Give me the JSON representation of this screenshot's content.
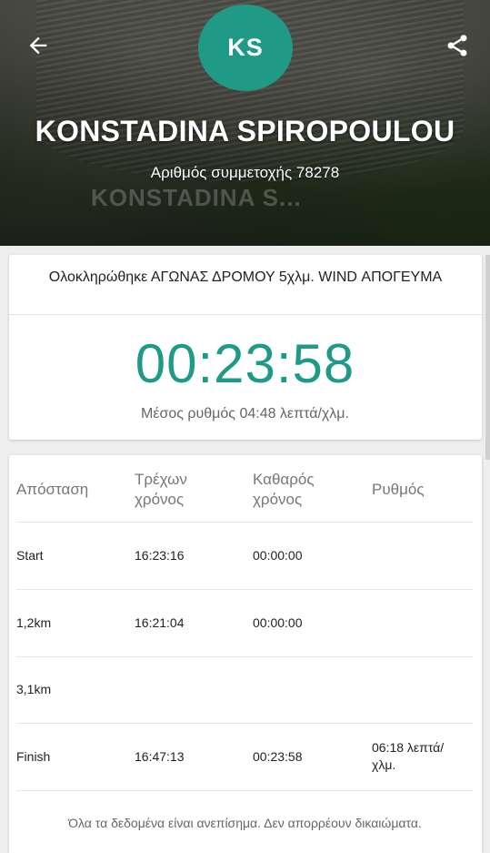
{
  "header": {
    "avatar_initials": "KS",
    "avatar_color": "#1e9a86",
    "athlete_name": "KONSTADINA SPIROPOULOU",
    "bib_text": "Αριθμός συμμετοχής 78278",
    "watermark_text": "KONSTADINA S...",
    "back_icon": "arrow-left-icon",
    "share_icon": "share-icon"
  },
  "result": {
    "race_title": "Ολοκληρώθηκε ΑΓΩΝΑΣ ΔΡΟΜΟΥ 5χλμ. WIND ΑΠΟΓΕΥΜΑ",
    "finish_time": "00:23:58",
    "pace_text": "Μέσος ρυθμός 04:48 λεπτά/χλμ.",
    "accent_color": "#1e9a86"
  },
  "splits": {
    "columns": [
      "Απόσταση",
      "Τρέχων χρόνος",
      "Καθαρός χρόνος",
      "Ρυθμός"
    ],
    "rows": [
      {
        "distance": "Start",
        "clock_time": "16:23:16",
        "net_time": "00:00:00",
        "pace": ""
      },
      {
        "distance": "1,2km",
        "clock_time": "16:21:04",
        "net_time": "00:00:00",
        "pace": ""
      },
      {
        "distance": "3,1km",
        "clock_time": "",
        "net_time": "",
        "pace": ""
      },
      {
        "distance": "Finish",
        "clock_time": "16:47:13",
        "net_time": "00:23:58",
        "pace": "06:18 λεπτά/χλμ."
      }
    ]
  },
  "footer": {
    "disclaimer": "Όλα τα δεδομένα είναι ανεπίσημα. Δεν απορρέουν δικαιώματα."
  }
}
